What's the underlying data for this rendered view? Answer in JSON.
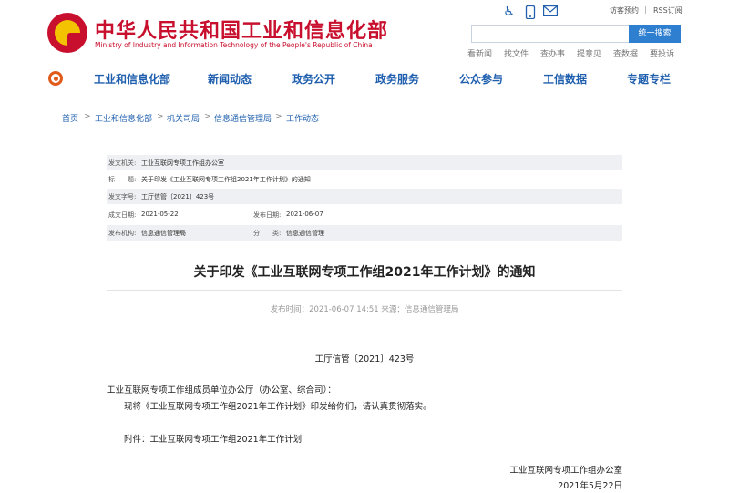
{
  "header": {
    "title": "中华人民共和国工业和信息化部",
    "subtitle": "Ministry of Industry and Information Technology of the People's Republic of China",
    "util_links": [
      "访客预约",
      "RSS订阅"
    ],
    "search_button": "统一搜索",
    "quick_links": [
      "看新闻",
      "找文件",
      "查办事",
      "提意见",
      "查数据",
      "要投诉"
    ],
    "icons": [
      "accessibility-icon",
      "mobile-icon",
      "email-icon"
    ]
  },
  "nav": {
    "items": [
      "工业和信息化部",
      "新闻动态",
      "政务公开",
      "政务服务",
      "公众参与",
      "工信数据",
      "专题专栏"
    ]
  },
  "breadcrumb": [
    "首页",
    "工业和信息化部",
    "机关司局",
    "信息通信管理局",
    "工作动态"
  ],
  "meta": {
    "issuer_label": "发文机关:",
    "issuer": "工业互联网专项工作组办公室",
    "title_label": "标　　题:",
    "title": "关于印发《工业互联网专项工作组2021年工作计划》的通知",
    "doc_no_label": "发文字号:",
    "doc_no": "工厅信管〔2021〕423号",
    "date_label": "成文日期:",
    "date": "2021-05-22",
    "pub_date_label": "发布日期:",
    "pub_date": "2021-06-07",
    "org_label": "发布机构:",
    "org": "信息通信管理局",
    "cat_label": "分　　类:",
    "cat": "信息通信管理"
  },
  "article": {
    "title": "关于印发《工业互联网专项工作组2021年工作计划》的通知",
    "pubinfo": "发布时间：2021-06-07 14:51   来源：信息通信管理局",
    "doc_number": "工厅信管〔2021〕423号",
    "recipient": "工业互联网专项工作组成员单位办公厅（办公室、综合司）：",
    "body": "现将《工业互联网专项工作组2021年工作计划》印发给你们，请认真贯彻落实。",
    "attachment": "附件：工业互联网专项工作组2021年工作计划",
    "signer": "工业互联网专项工作组办公室",
    "sign_date": "2021年5月22日"
  }
}
